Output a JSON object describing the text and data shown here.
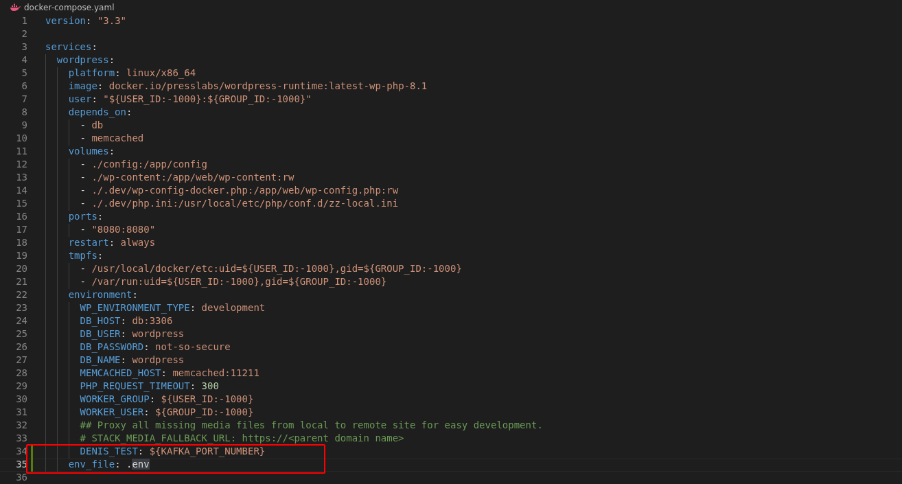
{
  "tab": {
    "title": "docker-compose.yaml"
  },
  "lines": [
    {
      "number": "1",
      "tokens": [
        {
          "kind": "key",
          "text": "version"
        },
        {
          "kind": "punct",
          "text": ": "
        },
        {
          "kind": "string",
          "text": "\"3.3\""
        }
      ]
    },
    {
      "number": "2"
    },
    {
      "number": "3",
      "tokens": [
        {
          "kind": "key",
          "text": "services"
        },
        {
          "kind": "punct",
          "text": ":"
        }
      ],
      "children": [
        {
          "number": "4",
          "tokens": [
            {
              "kind": "key",
              "text": "wordpress"
            },
            {
              "kind": "punct",
              "text": ":"
            }
          ],
          "children": [
            {
              "number": "5",
              "tokens": [
                {
                  "kind": "key",
                  "text": "platform"
                },
                {
                  "kind": "punct",
                  "text": ": "
                },
                {
                  "kind": "string",
                  "text": "linux/x86_64"
                }
              ]
            },
            {
              "number": "6",
              "tokens": [
                {
                  "kind": "key",
                  "text": "image"
                },
                {
                  "kind": "punct",
                  "text": ": "
                },
                {
                  "kind": "string",
                  "text": "docker.io/presslabs/wordpress-runtime:latest-wp-php-8.1"
                }
              ]
            },
            {
              "number": "7",
              "tokens": [
                {
                  "kind": "key",
                  "text": "user"
                },
                {
                  "kind": "punct",
                  "text": ": "
                },
                {
                  "kind": "string",
                  "text": "\"${USER_ID:-1000}:${GROUP_ID:-1000}\""
                }
              ]
            },
            {
              "number": "8",
              "tokens": [
                {
                  "kind": "key",
                  "text": "depends_on"
                },
                {
                  "kind": "punct",
                  "text": ":"
                }
              ],
              "children": [
                {
                  "number": "9",
                  "tokens": [
                    {
                      "kind": "punct",
                      "text": "- "
                    },
                    {
                      "kind": "string",
                      "text": "db"
                    }
                  ]
                },
                {
                  "number": "10",
                  "tokens": [
                    {
                      "kind": "punct",
                      "text": "- "
                    },
                    {
                      "kind": "string",
                      "text": "memcached"
                    }
                  ]
                }
              ]
            },
            {
              "number": "11",
              "tokens": [
                {
                  "kind": "key",
                  "text": "volumes"
                },
                {
                  "kind": "punct",
                  "text": ":"
                }
              ],
              "children": [
                {
                  "number": "12",
                  "tokens": [
                    {
                      "kind": "punct",
                      "text": "- "
                    },
                    {
                      "kind": "string",
                      "text": "./config:/app/config"
                    }
                  ]
                },
                {
                  "number": "13",
                  "tokens": [
                    {
                      "kind": "punct",
                      "text": "- "
                    },
                    {
                      "kind": "string",
                      "text": "./wp-content:/app/web/wp-content:rw"
                    }
                  ]
                },
                {
                  "number": "14",
                  "tokens": [
                    {
                      "kind": "punct",
                      "text": "- "
                    },
                    {
                      "kind": "string",
                      "text": "./.dev/wp-config-docker.php:/app/web/wp-config.php:rw"
                    }
                  ]
                },
                {
                  "number": "15",
                  "tokens": [
                    {
                      "kind": "punct",
                      "text": "- "
                    },
                    {
                      "kind": "string",
                      "text": "./.dev/php.ini:/usr/local/etc/php/conf.d/zz-local.ini"
                    }
                  ]
                }
              ]
            },
            {
              "number": "16",
              "tokens": [
                {
                  "kind": "key",
                  "text": "ports"
                },
                {
                  "kind": "punct",
                  "text": ":"
                }
              ],
              "children": [
                {
                  "number": "17",
                  "tokens": [
                    {
                      "kind": "punct",
                      "text": "- "
                    },
                    {
                      "kind": "string",
                      "text": "\"8080:8080\""
                    }
                  ]
                }
              ]
            },
            {
              "number": "18",
              "tokens": [
                {
                  "kind": "key",
                  "text": "restart"
                },
                {
                  "kind": "punct",
                  "text": ": "
                },
                {
                  "kind": "string",
                  "text": "always"
                }
              ]
            },
            {
              "number": "19",
              "tokens": [
                {
                  "kind": "key",
                  "text": "tmpfs"
                },
                {
                  "kind": "punct",
                  "text": ":"
                }
              ],
              "children": [
                {
                  "number": "20",
                  "tokens": [
                    {
                      "kind": "punct",
                      "text": "- "
                    },
                    {
                      "kind": "string",
                      "text": "/usr/local/docker/etc:uid=${USER_ID:-1000},gid=${GROUP_ID:-1000}"
                    }
                  ]
                },
                {
                  "number": "21",
                  "tokens": [
                    {
                      "kind": "punct",
                      "text": "- "
                    },
                    {
                      "kind": "string",
                      "text": "/var/run:uid=${USER_ID:-1000},gid=${GROUP_ID:-1000}"
                    }
                  ]
                }
              ]
            },
            {
              "number": "22",
              "tokens": [
                {
                  "kind": "key",
                  "text": "environment"
                },
                {
                  "kind": "punct",
                  "text": ":"
                }
              ],
              "children": [
                {
                  "number": "23",
                  "tokens": [
                    {
                      "kind": "key",
                      "text": "WP_ENVIRONMENT_TYPE"
                    },
                    {
                      "kind": "punct",
                      "text": ": "
                    },
                    {
                      "kind": "string",
                      "text": "development"
                    }
                  ]
                },
                {
                  "number": "24",
                  "tokens": [
                    {
                      "kind": "key",
                      "text": "DB_HOST"
                    },
                    {
                      "kind": "punct",
                      "text": ": "
                    },
                    {
                      "kind": "string",
                      "text": "db:3306"
                    }
                  ]
                },
                {
                  "number": "25",
                  "tokens": [
                    {
                      "kind": "key",
                      "text": "DB_USER"
                    },
                    {
                      "kind": "punct",
                      "text": ": "
                    },
                    {
                      "kind": "string",
                      "text": "wordpress"
                    }
                  ]
                },
                {
                  "number": "26",
                  "tokens": [
                    {
                      "kind": "key",
                      "text": "DB_PASSWORD"
                    },
                    {
                      "kind": "punct",
                      "text": ": "
                    },
                    {
                      "kind": "string",
                      "text": "not-so-secure"
                    }
                  ]
                },
                {
                  "number": "27",
                  "tokens": [
                    {
                      "kind": "key",
                      "text": "DB_NAME"
                    },
                    {
                      "kind": "punct",
                      "text": ": "
                    },
                    {
                      "kind": "string",
                      "text": "wordpress"
                    }
                  ]
                },
                {
                  "number": "28",
                  "tokens": [
                    {
                      "kind": "key",
                      "text": "MEMCACHED_HOST"
                    },
                    {
                      "kind": "punct",
                      "text": ": "
                    },
                    {
                      "kind": "string",
                      "text": "memcached:11211"
                    }
                  ]
                },
                {
                  "number": "29",
                  "tokens": [
                    {
                      "kind": "key",
                      "text": "PHP_REQUEST_TIMEOUT"
                    },
                    {
                      "kind": "punct",
                      "text": ": "
                    },
                    {
                      "kind": "number",
                      "text": "300"
                    }
                  ]
                },
                {
                  "number": "30",
                  "tokens": [
                    {
                      "kind": "key",
                      "text": "WORKER_GROUP"
                    },
                    {
                      "kind": "punct",
                      "text": ": "
                    },
                    {
                      "kind": "string",
                      "text": "${USER_ID:-1000}"
                    }
                  ]
                },
                {
                  "number": "31",
                  "tokens": [
                    {
                      "kind": "key",
                      "text": "WORKER_USER"
                    },
                    {
                      "kind": "punct",
                      "text": ": "
                    },
                    {
                      "kind": "string",
                      "text": "${GROUP_ID:-1000}"
                    }
                  ]
                },
                {
                  "number": "32",
                  "tokens": [
                    {
                      "kind": "comment",
                      "text": "## Proxy all missing media files from local to remote site for easy development."
                    }
                  ]
                },
                {
                  "number": "33",
                  "tokens": [
                    {
                      "kind": "comment",
                      "text": "# STACK_MEDIA_FALLBACK_URL: https://<parent domain name>"
                    }
                  ]
                },
                {
                  "number": "34",
                  "modified": true,
                  "boxed": true,
                  "tokens": [
                    {
                      "kind": "key",
                      "text": "DENIS_TEST"
                    },
                    {
                      "kind": "punct",
                      "text": ": "
                    },
                    {
                      "kind": "string",
                      "text": "${KAFKA_PORT_NUMBER}"
                    }
                  ]
                }
              ]
            },
            {
              "number": "35",
              "modified": true,
              "boxed": true,
              "current": true,
              "tokens": [
                {
                  "kind": "key",
                  "text": "env_file"
                },
                {
                  "kind": "punct",
                  "text": ": "
                },
                {
                  "kind": "punct",
                  "text": "."
                },
                {
                  "kind": "punct",
                  "text": "env",
                  "highlight": true
                }
              ]
            }
          ]
        }
      ]
    },
    {
      "number": "36"
    }
  ]
}
